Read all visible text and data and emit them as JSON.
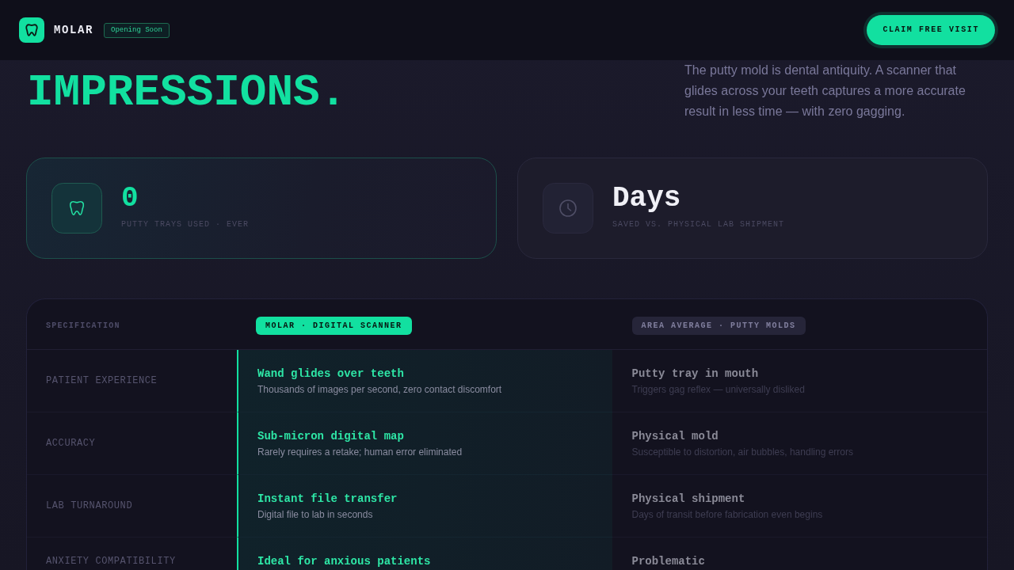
{
  "header": {
    "brand": "MOLAR",
    "badge": "Opening Soon",
    "cta": "CLAIM FREE VISIT"
  },
  "hero": {
    "heading": "IMPRESSIONS.",
    "description": "The putty mold is dental antiquity. A scanner that glides across your teeth captures a more accurate result in less time — with zero gagging."
  },
  "stats": [
    {
      "kind": "highlight",
      "value": "0",
      "label": "PUTTY TRAYS USED · EVER"
    },
    {
      "kind": "plain",
      "value": "Days",
      "label": "SAVED VS. PHYSICAL LAB SHIPMENT"
    }
  ],
  "comparison": {
    "columns": [
      {
        "kind": "label",
        "title": "SPECIFICATION"
      },
      {
        "kind": "featured",
        "title": "MOLAR · DIGITAL SCANNER"
      },
      {
        "kind": "muted",
        "title": "AREA AVERAGE · PUTTY MOLDS"
      }
    ],
    "rows": [
      {
        "cells": [
          {
            "title": "PATIENT EXPERIENCE"
          },
          {
            "title": "Wand glides over teeth",
            "detail": "Thousands of images per second, zero contact discomfort"
          },
          {
            "title": "Putty tray in mouth",
            "detail": "Triggers gag reflex — universally disliked"
          }
        ]
      },
      {
        "cells": [
          {
            "title": "ACCURACY"
          },
          {
            "title": "Sub-micron digital map",
            "detail": "Rarely requires a retake; human error eliminated"
          },
          {
            "title": "Physical mold",
            "detail": "Susceptible to distortion, air bubbles, handling errors"
          }
        ]
      },
      {
        "cells": [
          {
            "title": "LAB TURNAROUND"
          },
          {
            "title": "Instant file transfer",
            "detail": "Digital file to lab in seconds"
          },
          {
            "title": "Physical shipment",
            "detail": "Days of transit before fabrication even begins"
          }
        ]
      },
      {
        "cells": [
          {
            "title": "ANXIETY COMPATIBILITY"
          },
          {
            "title": "Ideal for anxious patients"
          },
          {
            "title": "Problematic"
          }
        ]
      }
    ]
  }
}
